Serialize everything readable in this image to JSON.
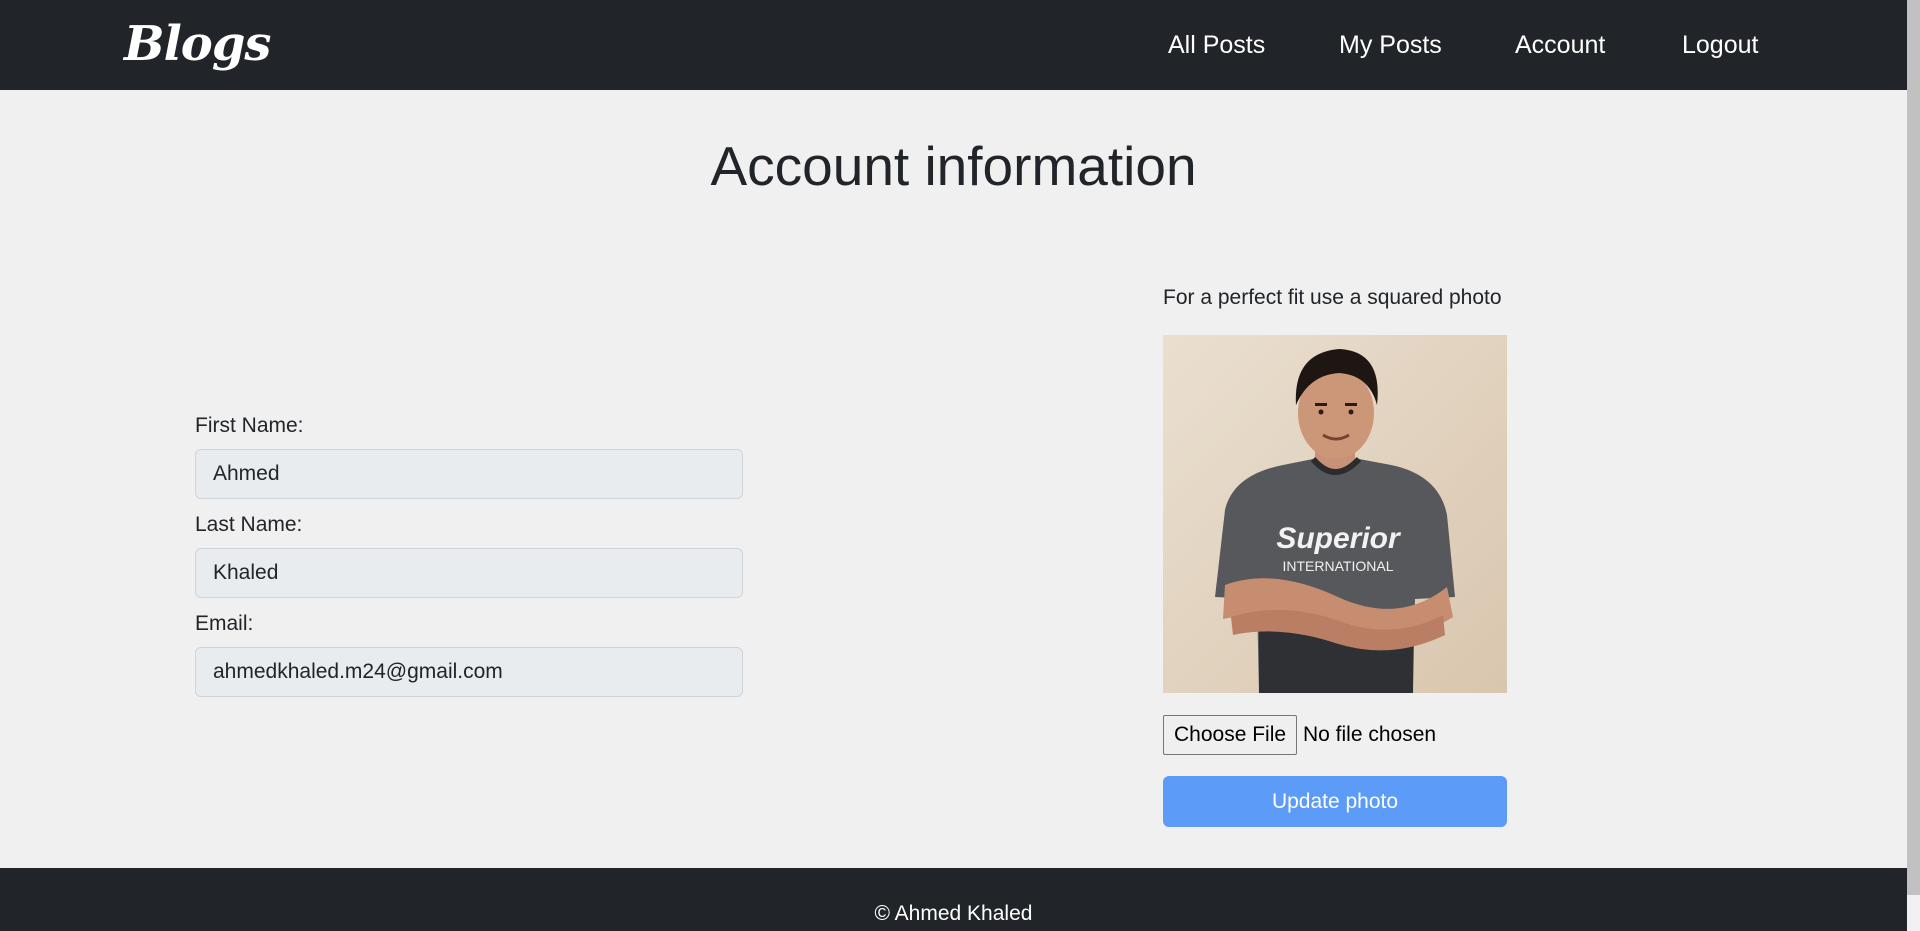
{
  "navbar": {
    "brand": "Blogs",
    "links": [
      "All Posts",
      "My Posts",
      "Account",
      "Logout"
    ]
  },
  "page": {
    "title": "Account information"
  },
  "form": {
    "first_name_label": "First Name:",
    "first_name_value": "Ahmed",
    "last_name_label": "Last Name:",
    "last_name_value": "Khaled",
    "email_label": "Email:",
    "email_value": "ahmedkhaled.m24@gmail.com"
  },
  "photo_panel": {
    "hint": "For a perfect fit use a squared photo",
    "shirt_text_main": "Superior",
    "shirt_text_sub": "INTERNATIONAL",
    "choose_file_label": "Choose File",
    "file_status": "No file chosen",
    "update_button": "Update photo"
  },
  "footer": {
    "text": "© Ahmed Khaled"
  },
  "colors": {
    "navbar_bg": "#212529",
    "page_bg": "#f0f0f0",
    "input_bg": "#e9ecef",
    "primary_button": "#5c9bf8"
  }
}
